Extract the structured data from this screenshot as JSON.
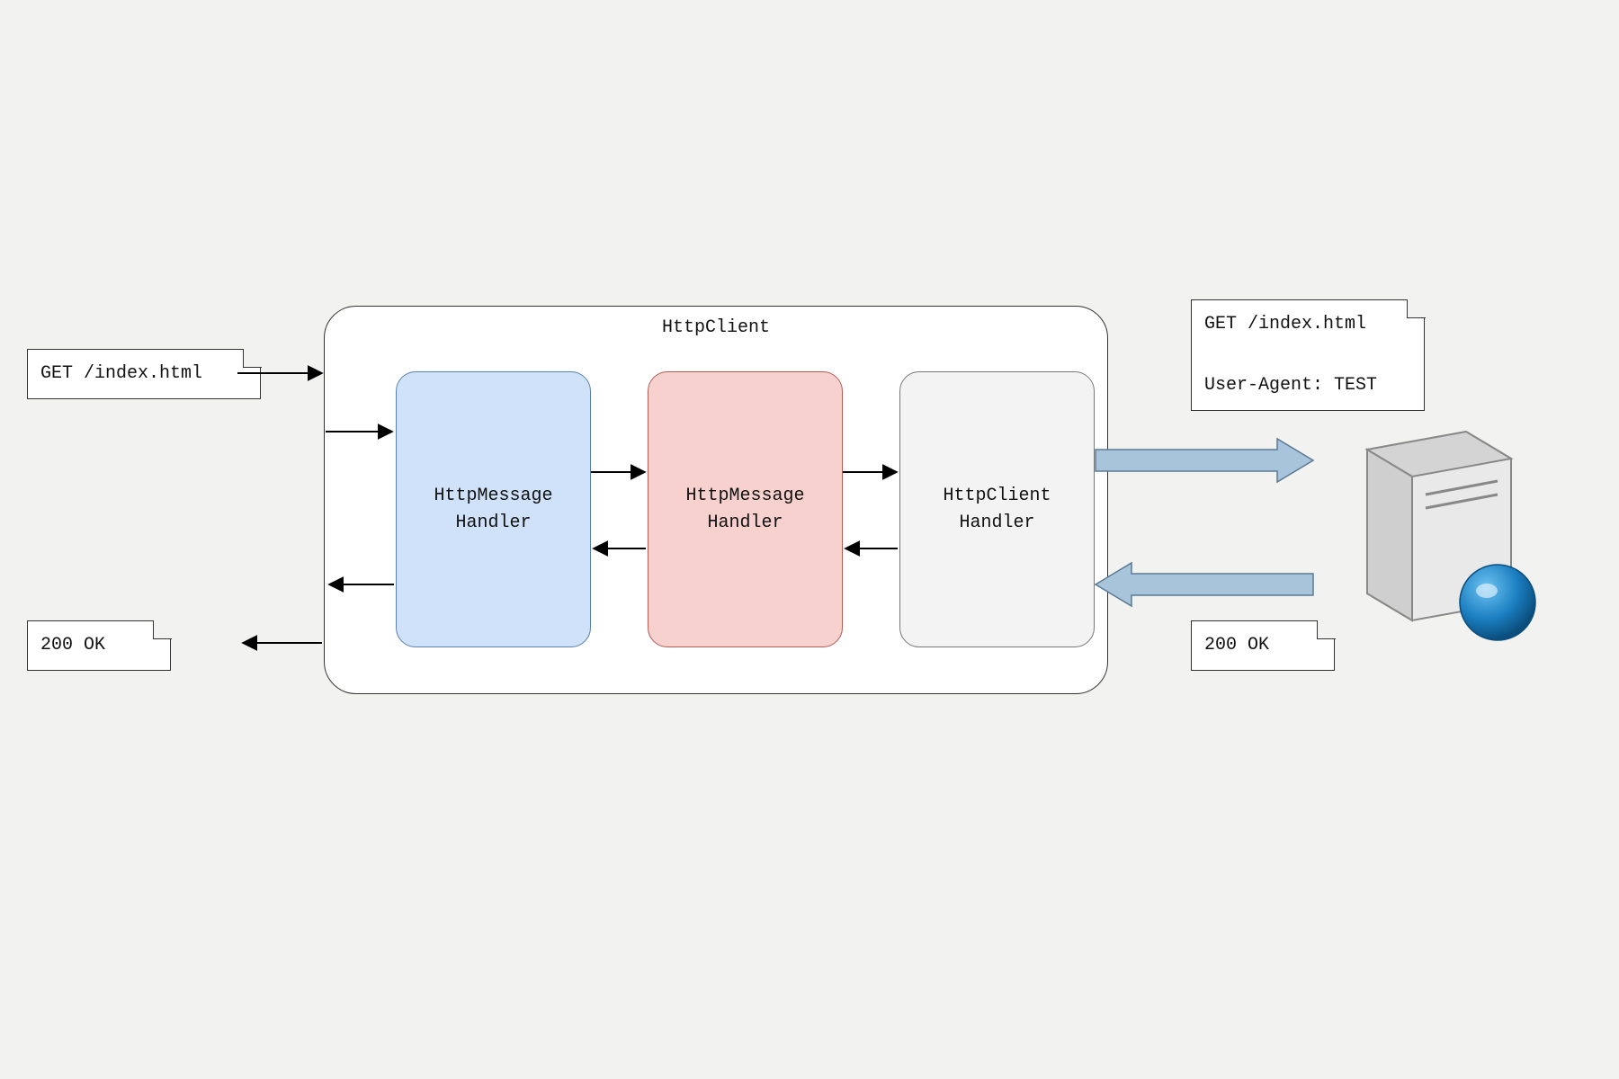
{
  "notes": {
    "left_request": "GET /index.html",
    "left_response": "200 OK",
    "right_request": "GET /index.html\n\nUser-Agent: TEST",
    "right_response": "200 OK"
  },
  "container": {
    "title": "HttpClient"
  },
  "handlers": {
    "h1": "HttpMessage\nHandler",
    "h2": "HttpMessage\nHandler",
    "h3": "HttpClient\nHandler"
  },
  "colors": {
    "handler1_bg": "#cfe2f9",
    "handler2_bg": "#f6d1ce",
    "handler3_bg": "#f3f3f3",
    "big_arrow_fill": "#a8c4da",
    "big_arrow_stroke": "#5b7a96"
  }
}
